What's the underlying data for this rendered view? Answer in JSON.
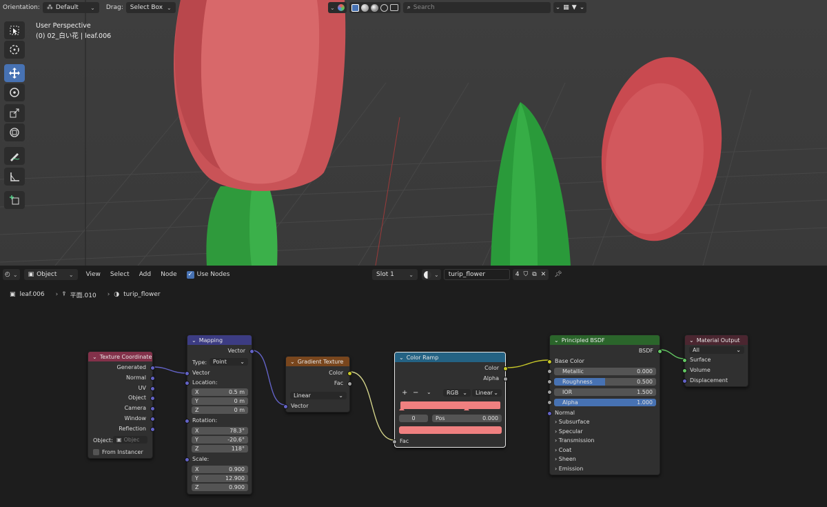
{
  "viewport": {
    "orientation_label": "Orientation:",
    "orientation_value": "Default",
    "drag_label": "Drag:",
    "drag_value": "Select Box",
    "search_placeholder": "Search",
    "view_name": "User Perspective",
    "object_info": "(0) 02_白い花 | leaf.006",
    "tools": [
      "select-box-icon",
      "cursor-icon",
      "move-icon",
      "rotate-icon",
      "scale-icon",
      "transform-icon",
      "annotate-icon",
      "measure-icon",
      "add-cube-icon"
    ]
  },
  "node_header": {
    "mode": "Object",
    "menus": [
      "View",
      "Select",
      "Add",
      "Node"
    ],
    "use_nodes_label": "Use Nodes",
    "use_nodes_checked": true,
    "slot": "Slot 1",
    "material": "turip_flower",
    "users": "4"
  },
  "breadcrumb": {
    "object": "leaf.006",
    "mesh": "平面.010",
    "material": "turip_flower"
  },
  "nodes": {
    "texcoord": {
      "title": "Texture Coordinate",
      "outputs": [
        "Generated",
        "Normal",
        "UV",
        "Object",
        "Camera",
        "Window",
        "Reflection"
      ],
      "object_label": "Object:",
      "object_placeholder": "Objec",
      "from_instancer": "From Instancer"
    },
    "mapping": {
      "title": "Mapping",
      "output": "Vector",
      "type_label": "Type:",
      "type_value": "Point",
      "vector_label": "Vector",
      "location_label": "Location:",
      "location": [
        {
          "k": "X",
          "v": "0.5 m"
        },
        {
          "k": "Y",
          "v": "0 m"
        },
        {
          "k": "Z",
          "v": "0 m"
        }
      ],
      "rotation_label": "Rotation:",
      "rotation": [
        {
          "k": "X",
          "v": "78.3°"
        },
        {
          "k": "Y",
          "v": "-20.6°"
        },
        {
          "k": "Z",
          "v": "118°"
        }
      ],
      "scale_label": "Scale:",
      "scale": [
        {
          "k": "X",
          "v": "0.900"
        },
        {
          "k": "Y",
          "v": "12.900"
        },
        {
          "k": "Z",
          "v": "0.900"
        }
      ]
    },
    "gradient": {
      "title": "Gradient Texture",
      "out_color": "Color",
      "out_fac": "Fac",
      "type": "Linear",
      "in_vector": "Vector"
    },
    "colorramp": {
      "title": "Color Ramp",
      "out_color": "Color",
      "out_alpha": "Alpha",
      "plus": "+",
      "minus": "−",
      "mode": "RGB",
      "interp": "Linear",
      "index": "0",
      "pos_label": "Pos",
      "pos_value": "0.000",
      "in_fac": "Fac",
      "ramp_color": "#f08080"
    },
    "bsdf": {
      "title": "Principled BSDF",
      "output": "BSDF",
      "base_color": "Base Color",
      "metallic_label": "Metallic",
      "metallic": "0.000",
      "roughness_label": "Roughness",
      "roughness": "0.500",
      "roughness_fraction": 0.5,
      "ior_label": "IOR",
      "ior": "1.500",
      "alpha_label": "Alpha",
      "alpha": "1.000",
      "alpha_fraction": 1.0,
      "normal": "Normal",
      "panels": [
        "Subsurface",
        "Specular",
        "Transmission",
        "Coat",
        "Sheen",
        "Emission"
      ]
    },
    "output": {
      "title": "Material Output",
      "target": "All",
      "inputs": [
        "Surface",
        "Volume",
        "Displacement"
      ]
    }
  },
  "colors": {
    "texture_header": "#83314a",
    "vector_header": "#3c3c83",
    "texture_node_header": "#79461d",
    "converter_header": "#246283",
    "shader_header": "#2b652b",
    "output_header": "#4b2630",
    "accent": "#4772b3"
  }
}
